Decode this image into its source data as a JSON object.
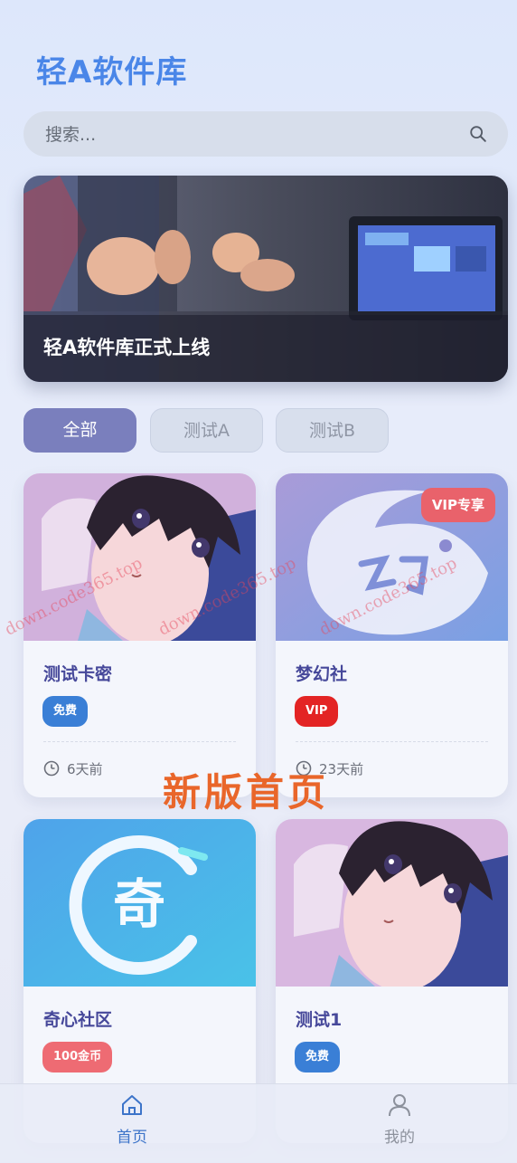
{
  "header": {
    "app_title": "轻A软件库"
  },
  "search": {
    "placeholder": "搜索..."
  },
  "banner": {
    "title": "轻A软件库正式上线"
  },
  "tabs": [
    {
      "label": "全部",
      "active": true
    },
    {
      "label": "测试A",
      "active": false
    },
    {
      "label": "测试B",
      "active": false
    }
  ],
  "cards": [
    {
      "title": "测试卡密",
      "badge": "免费",
      "badge_color": "#3a7fd6",
      "time": "6天前",
      "thumb": "anime-boy"
    },
    {
      "title": "梦幻社",
      "badge": "VIP",
      "badge_color": "#e32424",
      "time": "23天前",
      "thumb": "dream-logo",
      "corner_tag": "VIP专享"
    },
    {
      "title": "奇心社区",
      "badge": "100金币",
      "badge_color": "#ee6b73",
      "time": "",
      "thumb": "qi-logo"
    },
    {
      "title": "测试1",
      "badge": "免费",
      "badge_color": "#3a7fd6",
      "time": "",
      "thumb": "anime-boy"
    }
  ],
  "overlay": {
    "promo_text": "新版首页",
    "watermark": "down.code365.top"
  },
  "bottom_nav": [
    {
      "label": "首页",
      "icon": "home-icon",
      "active": true
    },
    {
      "label": "我的",
      "icon": "user-icon",
      "active": false
    }
  ],
  "colors": {
    "accent": "#4a86e8",
    "tab_active": "#7a7fbd",
    "nav_active": "#3d74c9",
    "nav_inactive": "#8c919c"
  }
}
